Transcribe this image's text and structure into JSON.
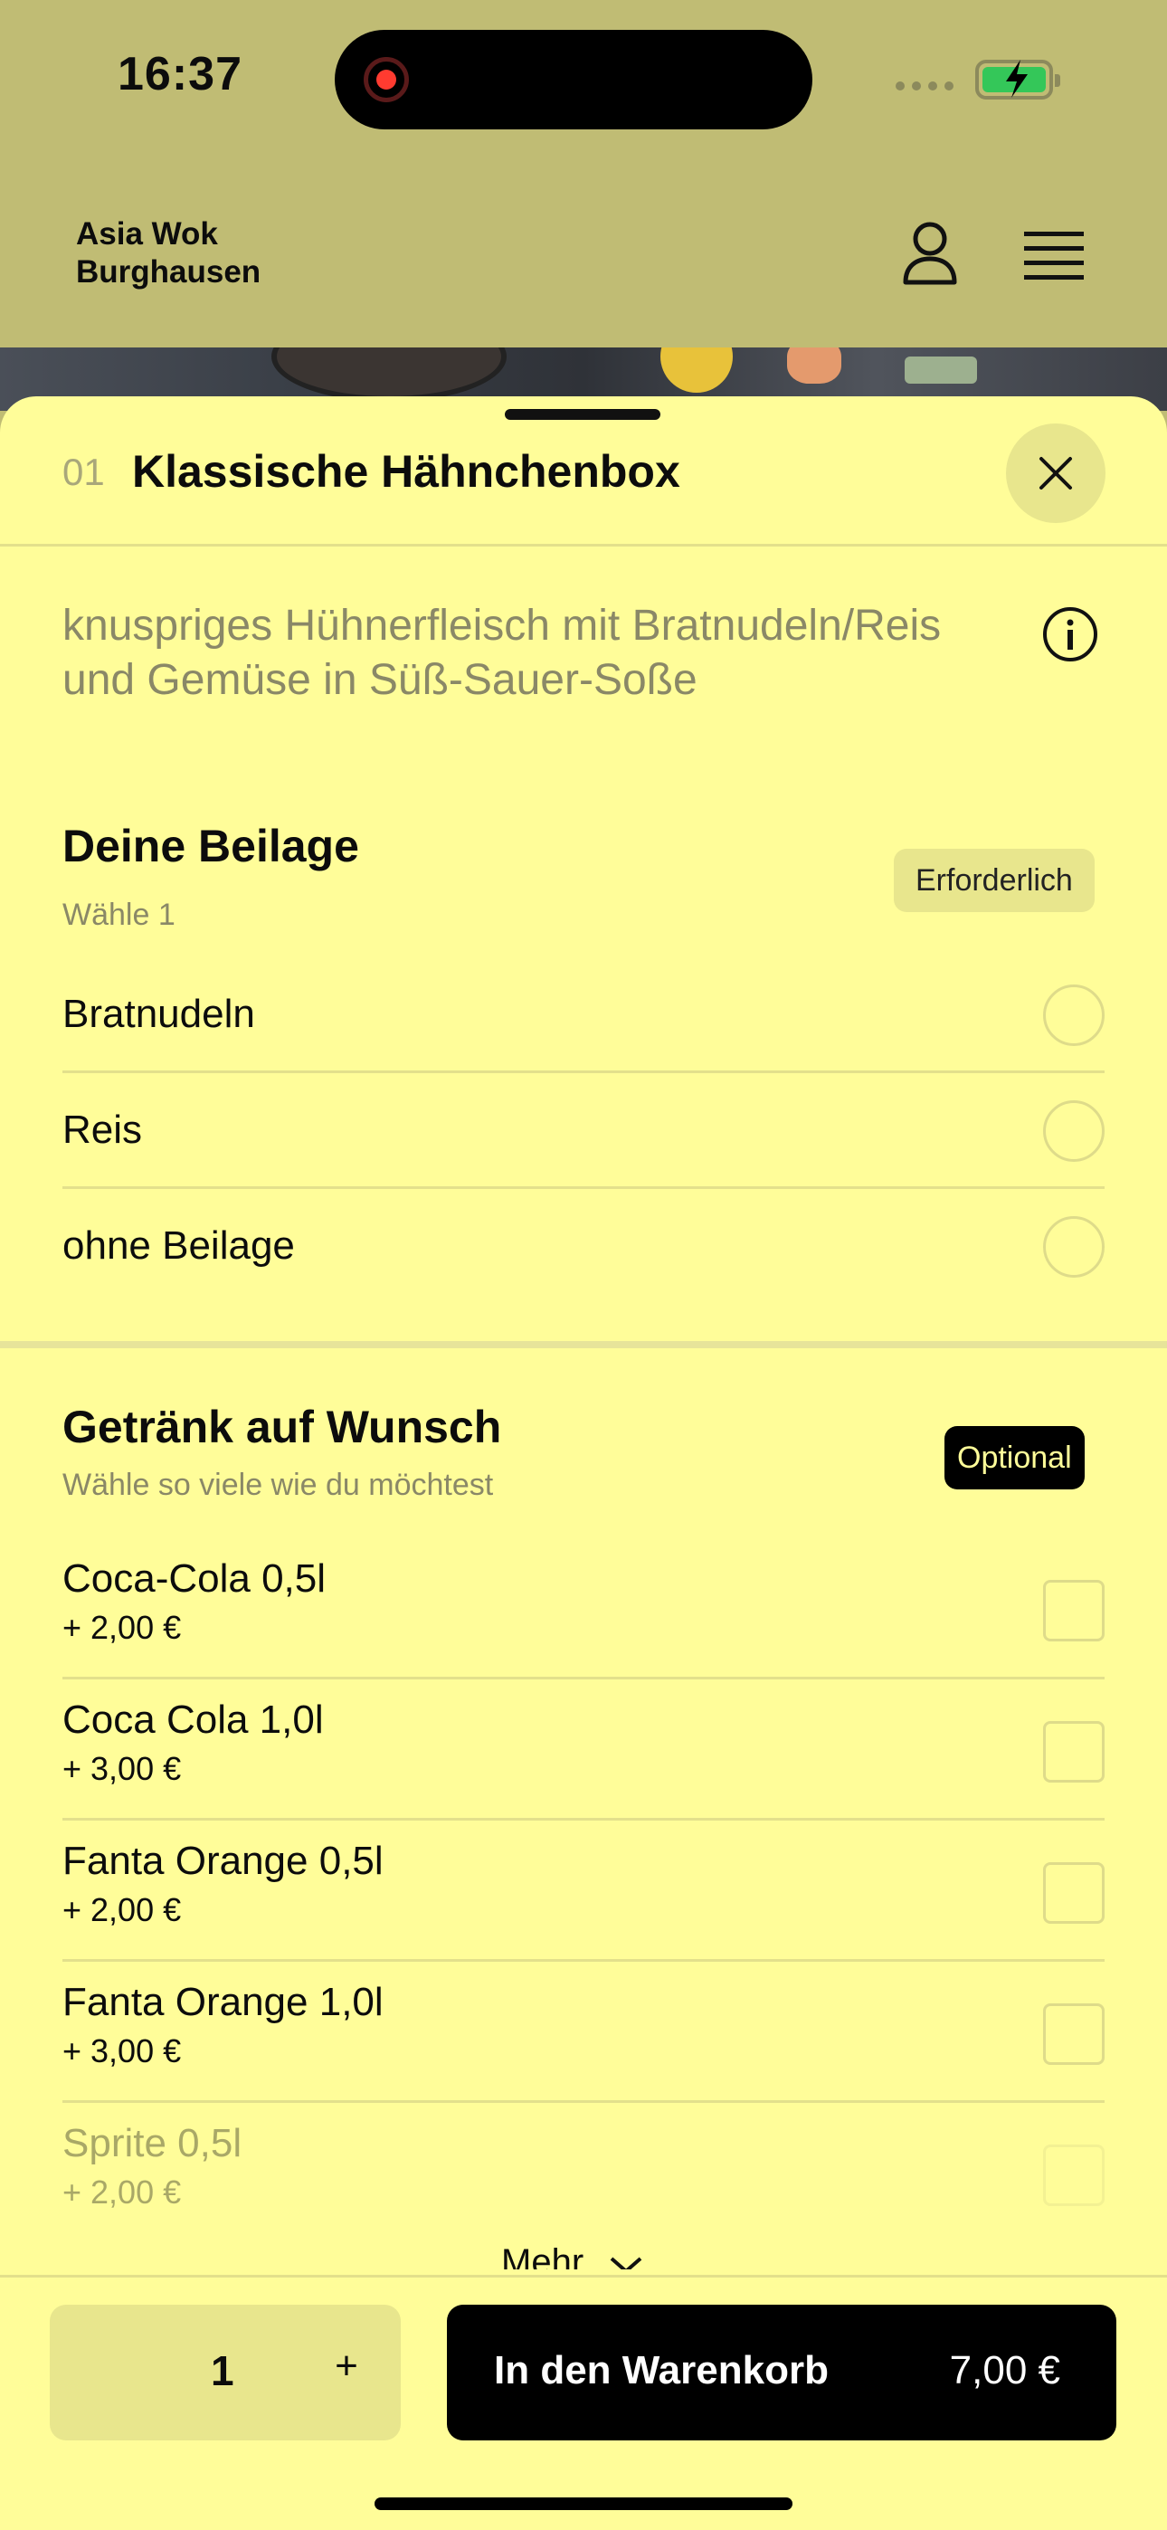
{
  "status_bar": {
    "time": "16:37"
  },
  "header": {
    "brand_line1": "Asia Wok",
    "brand_line2": "Burghausen"
  },
  "item": {
    "number": "01",
    "title": "Klassische Hähnchenbox",
    "description": "knuspriges Hühnerfleisch mit Bratnudeln/Reis und Gemüse in Süß-Sauer-Soße"
  },
  "side_group": {
    "title": "Deine Beilage",
    "subtitle": "Wähle 1",
    "badge": "Erforderlich",
    "options": [
      {
        "label": "Bratnudeln"
      },
      {
        "label": "Reis"
      },
      {
        "label": "ohne Beilage"
      }
    ]
  },
  "drink_group": {
    "title": "Getränk auf Wunsch",
    "subtitle": "Wähle so viele wie du möchtest",
    "badge": "Optional",
    "options": [
      {
        "label": "Coca-Cola 0,5l",
        "price": "+ 2,00 €"
      },
      {
        "label": "Coca Cola 1,0l",
        "price": "+ 3,00 €"
      },
      {
        "label": "Fanta Orange 0,5l",
        "price": "+ 2,00 €"
      },
      {
        "label": "Fanta Orange 1,0l",
        "price": "+ 3,00 €"
      },
      {
        "label": "Sprite 0,5l",
        "price": "+ 2,00 €"
      }
    ],
    "more_label": "Mehr"
  },
  "footer": {
    "quantity": "1",
    "plus": "+",
    "cart_label": "In den Warenkorb",
    "cart_price": "7,00 €"
  }
}
